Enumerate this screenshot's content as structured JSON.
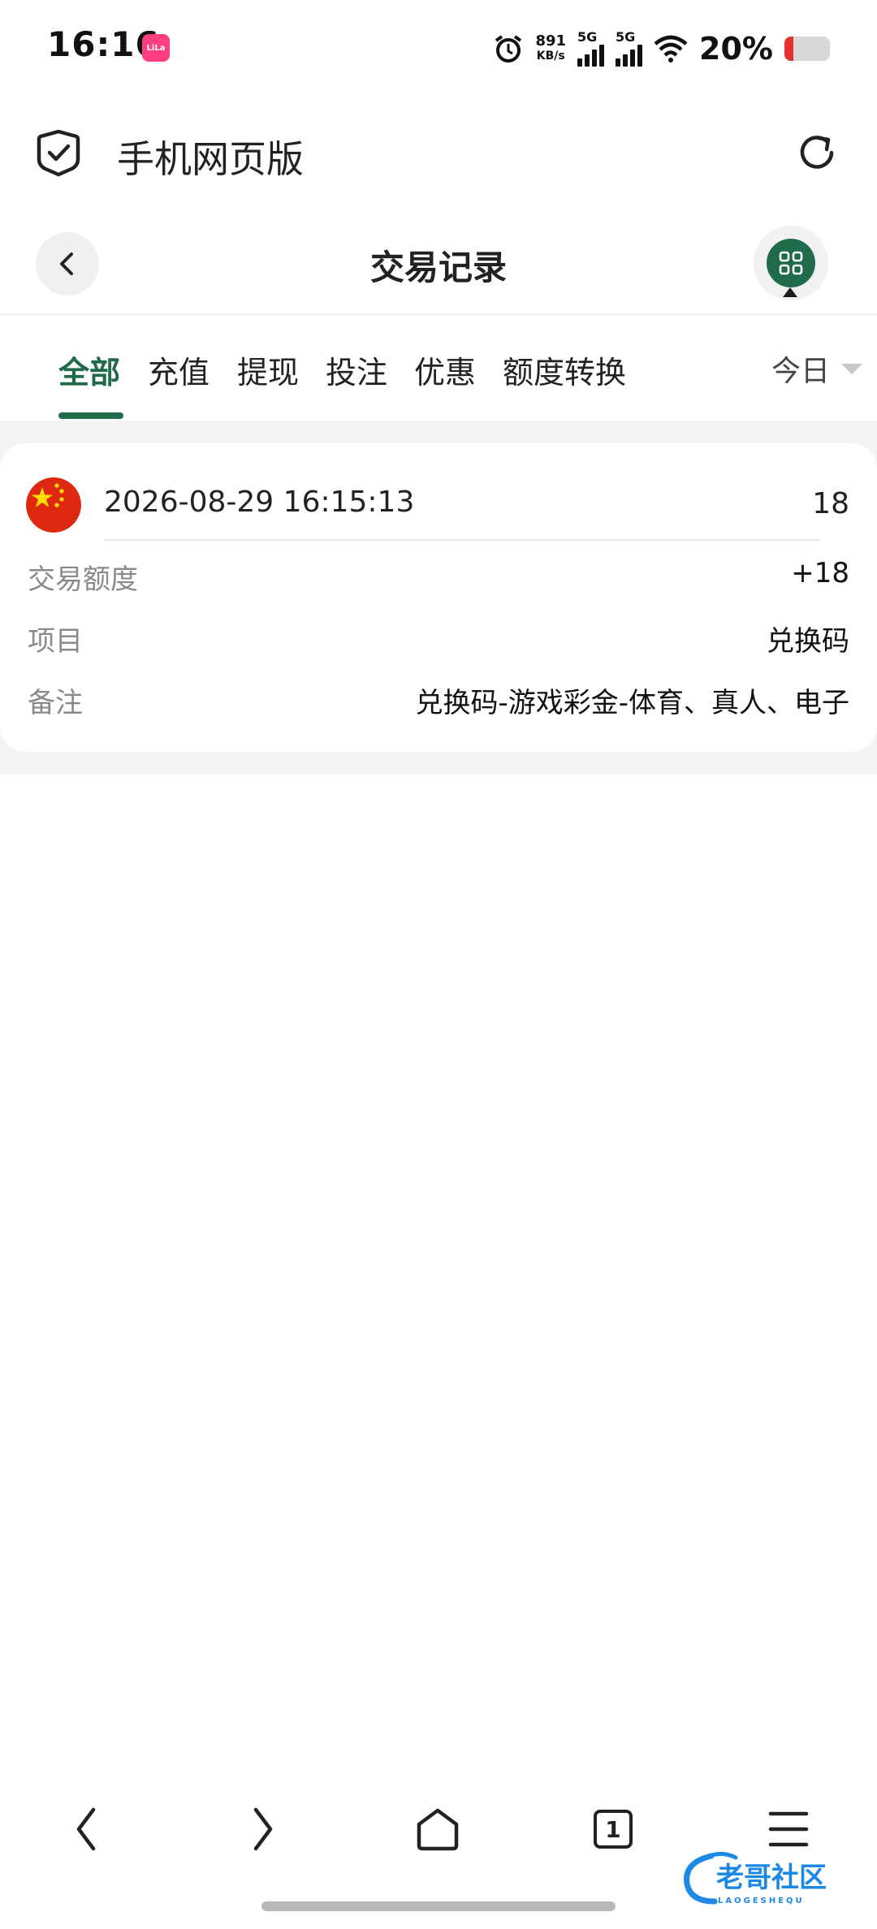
{
  "status_bar": {
    "time": "16:16",
    "app_badge": "LiLa",
    "speed_value": "891",
    "speed_unit": "KB/s",
    "sim1": "5G",
    "sim2": "5G",
    "battery_percent": "20%",
    "battery_level": 0.2,
    "battery_color": "#e8312f"
  },
  "browser": {
    "title": "手机网页版",
    "left_icon": "shield-check-icon",
    "right_icon": "reload-icon"
  },
  "page": {
    "title": "交易记录",
    "back_icon": "chevron-left-icon",
    "menu_icon": "grid-icon",
    "accent_color": "#1f6b4a"
  },
  "tabs": {
    "items": [
      {
        "label": "全部",
        "active": true
      },
      {
        "label": "充值",
        "active": false
      },
      {
        "label": "提现",
        "active": false
      },
      {
        "label": "投注",
        "active": false
      },
      {
        "label": "优惠",
        "active": false
      },
      {
        "label": "额度转换",
        "active": false
      }
    ],
    "date_filter": "今日"
  },
  "records": [
    {
      "flag": "china-flag-icon",
      "datetime": "2026-08-29 16:15:13",
      "number": "18",
      "fields": [
        {
          "label": "交易额度",
          "value": "+18"
        },
        {
          "label": "项目",
          "value": "兑换码"
        },
        {
          "label": "备注",
          "value": "兑换码-游戏彩金-体育、真人、电子"
        }
      ]
    }
  ],
  "bottom_nav": {
    "tab_count": "1",
    "items": [
      "back-icon",
      "forward-icon",
      "home-icon",
      "tabs-icon",
      "menu-icon"
    ]
  },
  "watermark": {
    "text": "老哥社区",
    "subtext": "LAOGESHEQU"
  }
}
